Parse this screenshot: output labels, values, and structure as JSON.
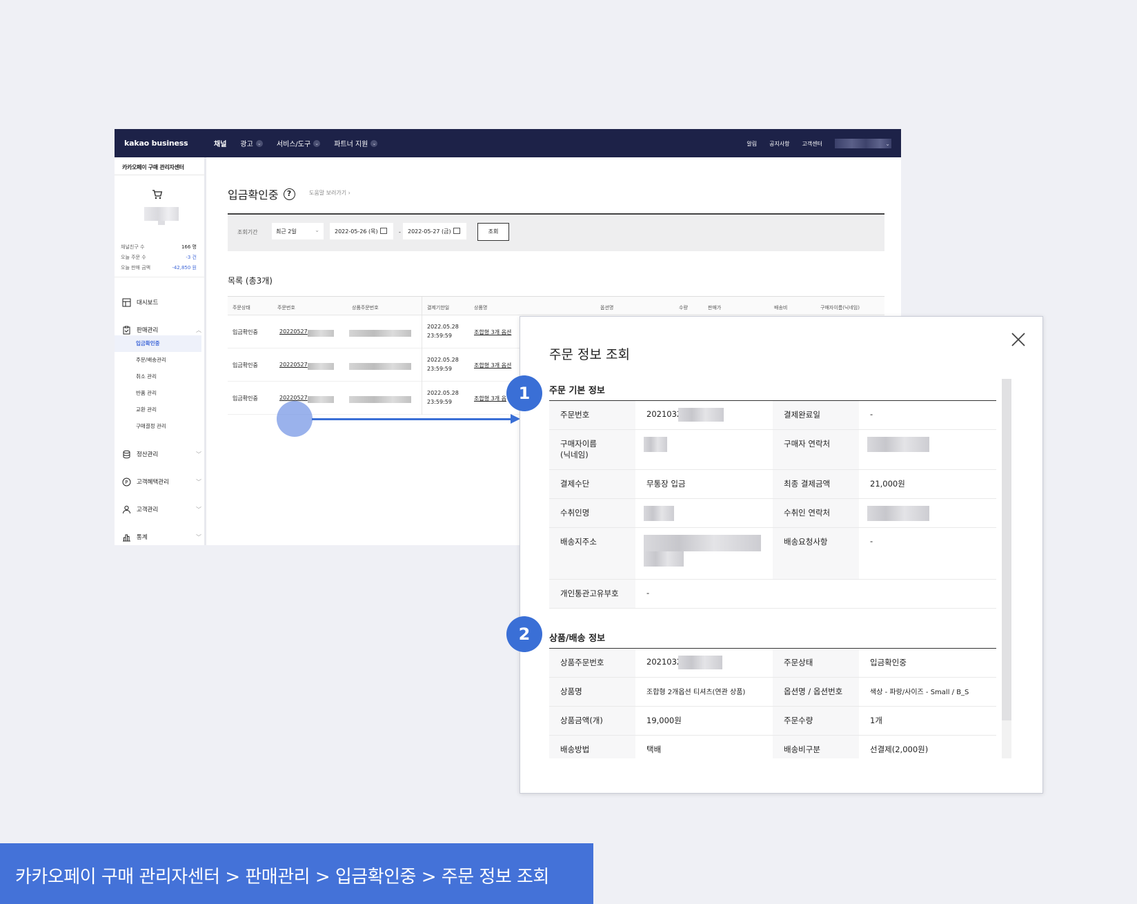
{
  "topnav": {
    "logo": "kakao business",
    "menu": [
      {
        "label": "채널",
        "dropdown": false
      },
      {
        "label": "광고",
        "dropdown": true
      },
      {
        "label": "서비스/도구",
        "dropdown": true
      },
      {
        "label": "파트너 지원",
        "dropdown": true
      }
    ],
    "right": [
      "알림",
      "공지사항",
      "고객센터"
    ]
  },
  "sidebar": {
    "header": "카카오페이 구매 관리자센터",
    "stats": [
      {
        "label": "채널친구 수",
        "value": "166 명"
      },
      {
        "label": "오늘 주문 수",
        "value": "-3 건"
      },
      {
        "label": "오늘 판매 금액",
        "value": "-42,850 원"
      }
    ],
    "menu": {
      "dashboard": "대시보드",
      "sales": "판매관리",
      "sales_sub": [
        "입금확인중",
        "주문/배송관리",
        "취소 관리",
        "반품 관리",
        "교환 관리",
        "구매결정 관리"
      ],
      "settlement": "정산관리",
      "benefit": "고객혜택관리",
      "customer": "고객관리",
      "stats": "통계"
    }
  },
  "content": {
    "title": "입금확인중",
    "help_icon": "?",
    "help_link": "도움말 보러가기 ›",
    "filter": {
      "label": "조회기간",
      "period": "최근 2일",
      "date_from": "2022-05-26 (목)",
      "date_to": "2022-05-27 (금)",
      "dash": "-",
      "search_btn": "조회"
    },
    "list_title": "목록 (총3개)",
    "columns": [
      "주문상태",
      "주문번호",
      "상품주문번호",
      "결제기한일",
      "상품명",
      "옵션명",
      "수량",
      "판매가",
      "배송비",
      "구매자이름(닉네임)"
    ],
    "rows": [
      {
        "status": "입금확인중",
        "order_no": "20220527",
        "deadline_date": "2022.05.28",
        "deadline_time": "23:59:59",
        "product": "조합형 3개 옵션"
      },
      {
        "status": "입금확인중",
        "order_no": "20220527",
        "deadline_date": "2022.05.28",
        "deadline_time": "23:59:59",
        "product": "조합형 3개 옵션"
      },
      {
        "status": "입금확인중",
        "order_no": "20220527",
        "deadline_date": "2022.05.28",
        "deadline_time": "23:59:59",
        "product": "조합형 3개 옵"
      }
    ]
  },
  "modal": {
    "title": "주문 정보 조회",
    "basic": {
      "title": "주문 기본 정보",
      "order_no_label": "주문번호",
      "order_no": "2021032",
      "paid_date_label": "결제완료일",
      "paid_date": "-",
      "buyer_name_label_1": "구매자이름",
      "buyer_name_label_2": "(닉네임)",
      "buyer_phone_label": "구매자 연락처",
      "pay_method_label": "결제수단",
      "pay_method": "무통장 입금",
      "final_amount_label": "최종 결제금액",
      "final_amount": "21,000원",
      "receiver_label": "수취인명",
      "receiver_phone_label": "수취인 연락처",
      "address_label": "배송지주소",
      "request_label": "배송요청사항",
      "request": "-",
      "customs_label": "개인통관고유부호",
      "customs": "-"
    },
    "product": {
      "title": "상품/배송 정보",
      "item_no_label": "상품주문번호",
      "item_no": "2021032",
      "status_label": "주문상태",
      "status": "입금확인중",
      "name_label": "상품명",
      "name": "조합형 2개옵션 티셔츠(연관 상품)",
      "option_label": "옵션명 / 옵션번호",
      "option": "색상 - 파랑/사이즈 - Small / B_S",
      "price_label": "상품금액(개)",
      "price": "19,000원",
      "qty_label": "주문수량",
      "qty": "1개",
      "ship_method_label": "배송방법",
      "ship_method": "택배",
      "ship_fee_label": "배송비구분",
      "ship_fee": "선결제(2,000원)"
    }
  },
  "annotations": {
    "badge1": "1",
    "badge2": "2"
  },
  "caption": "카카오페이 구매 관리자센터 > 판매관리 > 입금확인중 > 주문 정보 조회",
  "colors": {
    "nav_bg": "#1d2248",
    "accent": "#3a6fd6",
    "caption_bg": "#4472d8"
  }
}
